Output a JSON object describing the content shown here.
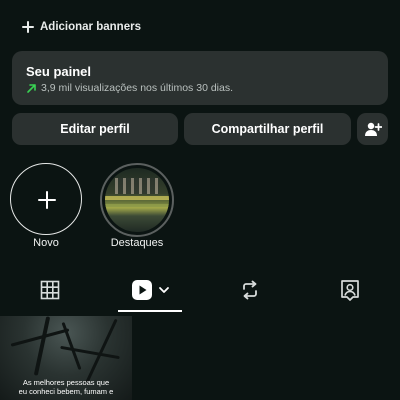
{
  "banners": {
    "add_label": "Adicionar banners"
  },
  "panel": {
    "title": "Seu painel",
    "subtitle": "3,9 mil visualizações nos últimos 30 dias.",
    "trend_color": "#39d353"
  },
  "buttons": {
    "edit": "Editar perfil",
    "share": "Compartilhar perfil",
    "add_person_icon": "person-add-icon"
  },
  "highlights": [
    {
      "label": "Novo",
      "icon": "plus-icon"
    },
    {
      "label": "Destaques",
      "icon": "highlight-cover"
    }
  ],
  "tabs": [
    {
      "icon": "grid-icon",
      "active": false
    },
    {
      "icon": "reels-icon",
      "active": true
    },
    {
      "icon": "reposts-icon",
      "active": false
    },
    {
      "icon": "tagged-icon",
      "active": false
    }
  ],
  "posts": [
    {
      "caption_line1": "As melhores pessoas que",
      "caption_line2": "eu conheci bebem, fumam e"
    }
  ]
}
